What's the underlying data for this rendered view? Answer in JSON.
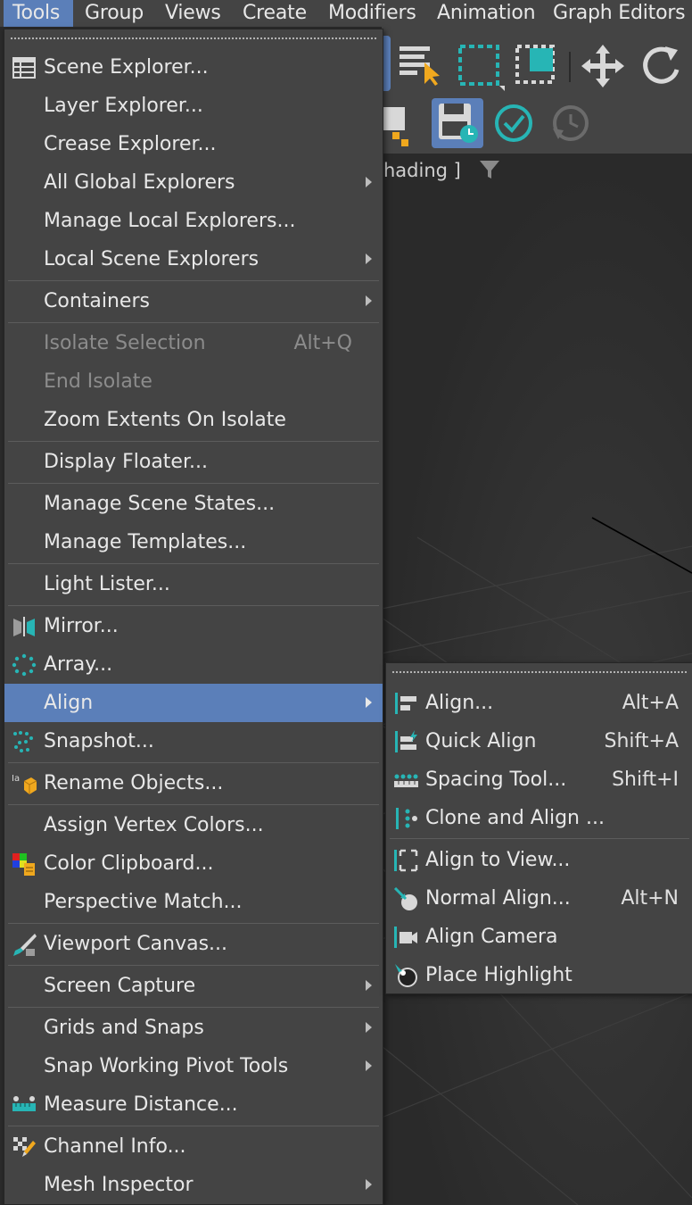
{
  "menubar": {
    "items": [
      "Tools",
      "Group",
      "Views",
      "Create",
      "Modifiers",
      "Animation",
      "Graph Editors"
    ]
  },
  "viewport": {
    "label": "hading ]"
  },
  "tools_menu": {
    "items": [
      {
        "label": "Scene Explorer...",
        "icon": "table-icon"
      },
      {
        "label": "Layer Explorer..."
      },
      {
        "label": "Crease Explorer..."
      },
      {
        "label": "All Global Explorers",
        "submenu": true
      },
      {
        "label": "Manage Local Explorers..."
      },
      {
        "label": "Local Scene Explorers",
        "submenu": true
      },
      {
        "label": "Containers",
        "submenu": true
      },
      {
        "label": "Isolate Selection",
        "shortcut": "Alt+Q",
        "disabled": true
      },
      {
        "label": "End Isolate",
        "disabled": true
      },
      {
        "label": "Zoom Extents On Isolate"
      },
      {
        "label": "Display Floater..."
      },
      {
        "label": "Manage Scene States..."
      },
      {
        "label": "Manage Templates..."
      },
      {
        "label": "Light Lister..."
      },
      {
        "label": "Mirror...",
        "icon": "mirror-icon"
      },
      {
        "label": "Array...",
        "icon": "array-icon"
      },
      {
        "label": "Align",
        "submenu": true,
        "selected": true
      },
      {
        "label": "Snapshot...",
        "icon": "snapshot-icon"
      },
      {
        "label": "Rename Objects...",
        "icon": "rename-icon"
      },
      {
        "label": "Assign Vertex Colors..."
      },
      {
        "label": "Color Clipboard...",
        "icon": "color-clipboard-icon"
      },
      {
        "label": "Perspective Match..."
      },
      {
        "label": "Viewport Canvas...",
        "icon": "brush-icon"
      },
      {
        "label": "Screen Capture",
        "submenu": true
      },
      {
        "label": "Grids and Snaps",
        "submenu": true
      },
      {
        "label": "Snap Working Pivot Tools",
        "submenu": true
      },
      {
        "label": "Measure Distance...",
        "icon": "ruler-icon"
      },
      {
        "label": "Channel Info...",
        "icon": "channel-info-icon"
      },
      {
        "label": "Mesh Inspector",
        "submenu": true
      }
    ]
  },
  "align_submenu": {
    "items": [
      {
        "label": "Align...",
        "shortcut": "Alt+A",
        "icon": "align-icon"
      },
      {
        "label": "Quick Align",
        "shortcut": "Shift+A",
        "icon": "quick-align-icon"
      },
      {
        "label": "Spacing Tool...",
        "shortcut": "Shift+I",
        "icon": "spacing-tool-icon"
      },
      {
        "label": "Clone and Align ...",
        "icon": "clone-align-icon"
      },
      {
        "label": "Align to View...",
        "icon": "align-to-view-icon"
      },
      {
        "label": "Normal Align...",
        "shortcut": "Alt+N",
        "icon": "normal-align-icon"
      },
      {
        "label": "Align Camera",
        "icon": "camera-icon"
      },
      {
        "label": "Place Highlight",
        "icon": "highlight-icon"
      }
    ]
  },
  "colors": {
    "menu_bg": "#444444",
    "highlight": "#5b7fb9",
    "accent_teal": "#27b5b5"
  }
}
